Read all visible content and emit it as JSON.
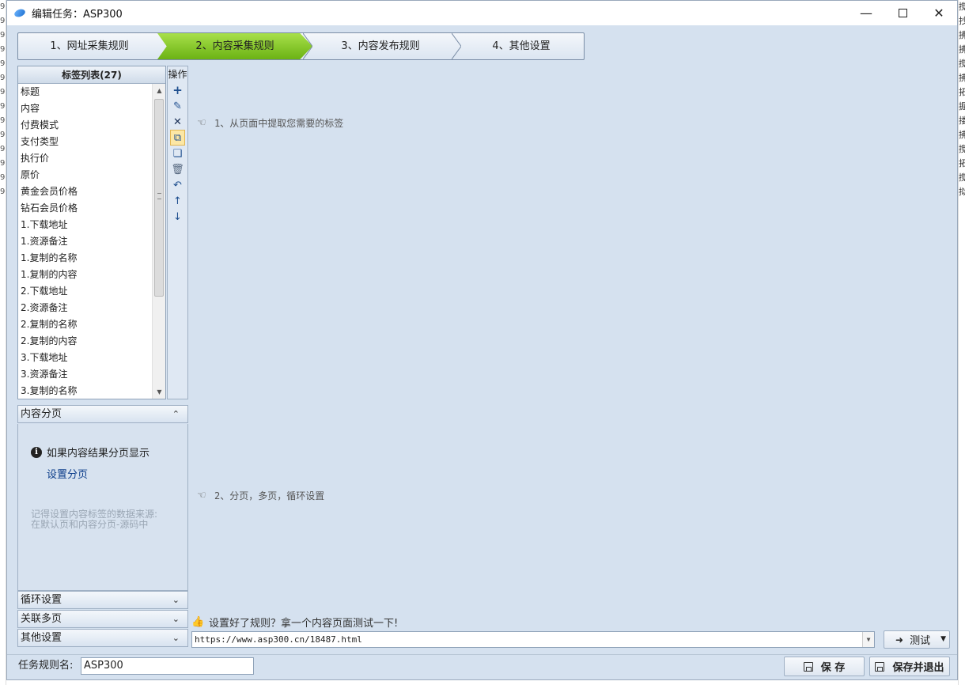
{
  "window": {
    "title": "编辑任务：ASP300"
  },
  "steps": [
    {
      "label": "1、网址采集规则"
    },
    {
      "label": "2、内容采集规则"
    },
    {
      "label": "3、内容发布规则"
    },
    {
      "label": "4、其他设置"
    }
  ],
  "tag_panel": {
    "header": "标签列表(27)",
    "items": [
      "标题",
      "内容",
      "付费模式",
      "支付类型",
      "执行价",
      "原价",
      "黄金会员价格",
      "钻石会员价格",
      "1.下载地址",
      "1.资源备注",
      "1.复制的名称",
      "1.复制的内容",
      "2.下载地址",
      "2.资源备注",
      "2.复制的名称",
      "2.复制的内容",
      "3.下载地址",
      "3.资源备注",
      "3.复制的名称"
    ]
  },
  "operations": {
    "title": "操作",
    "buttons": [
      "add-icon",
      "edit-icon",
      "delete-icon",
      "copy-icon",
      "paste-icon",
      "trash-icon",
      "undo-icon",
      "move-up-icon",
      "move-down-icon"
    ]
  },
  "pagination": {
    "header": "内容分页",
    "info": "如果内容结果分页显示",
    "link": "设置分页",
    "hint_line1": "记得设置内容标签的数据来源:",
    "hint_line2": "在默认页和内容分页-源码中"
  },
  "accordion": {
    "loop": "循环设置",
    "linked": "关联多页",
    "other": "其他设置"
  },
  "guides": {
    "extract": "1、从页面中提取您需要的标签",
    "paging": "2、分页，多页，循环设置"
  },
  "test": {
    "label": "设置好了规则？拿一个内容页面测试一下!",
    "url": "https://www.asp300.cn/18487.html",
    "button": "测试"
  },
  "bottom": {
    "task_label": "任务规则名:",
    "task_name": "ASP300",
    "save": "保 存",
    "save_exit": "保存并退出"
  },
  "bg_right_chars": [
    "搅",
    "抄",
    "拂",
    "拂",
    "搅",
    "拂",
    "拓",
    "掘",
    "搂",
    "拂",
    "搅",
    "拓",
    "搅",
    "拟"
  ]
}
